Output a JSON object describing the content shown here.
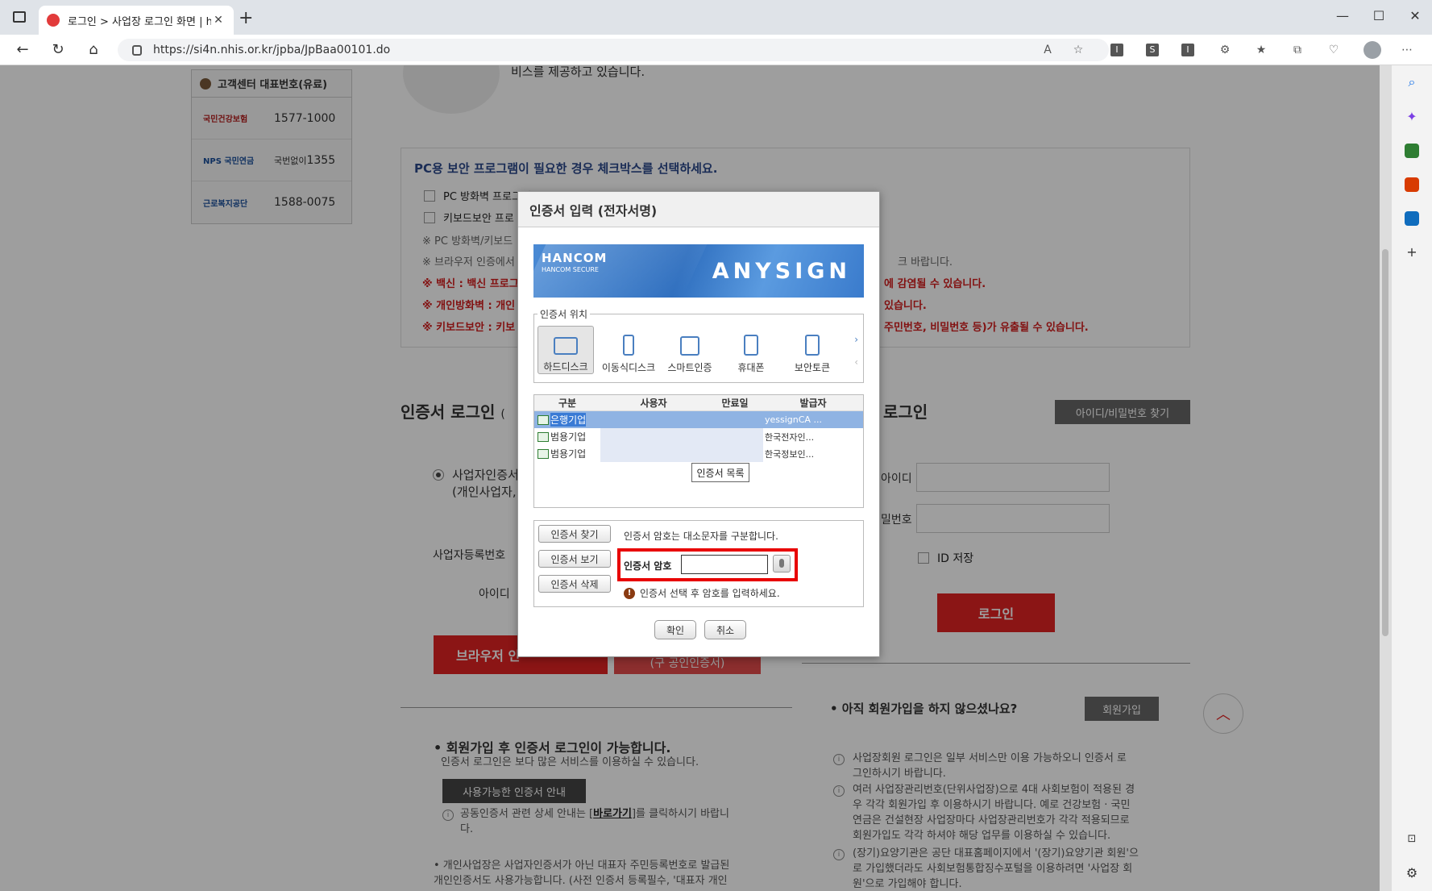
{
  "browser": {
    "tab_title": "로그인 > 사업장 로그인 화면 | h",
    "url": "https://si4n.nhis.or.kr/jpba/JpBaa00101.do"
  },
  "page": {
    "top_text": "비스를 제공하고 있습니다.",
    "customer_center": {
      "title": "고객센터 대표번호(유료)",
      "rows": [
        {
          "org": "국민건강보험",
          "num": "1577-1000"
        },
        {
          "org": "NPS 국민연금",
          "prefix": "국번없이",
          "num": "1355"
        },
        {
          "org": "근로복지공단",
          "num": "1588-0075"
        }
      ]
    },
    "security": {
      "title": "PC용 보안 프로그램이 필요한 경우 체크박스를 선택하세요.",
      "checkbox1": "PC 방화벽 프로그램 선택 설치",
      "checkbox2": "키보드보안 프로",
      "note1": "※ PC 방화벽/키보드",
      "note2": "※ 브라우저 인증에서",
      "note2_tail": "크 바랍니다.",
      "red1": "※ 백신 : 백신 프로그",
      "red1_tail": "에 감염될 수 있습니다.",
      "red2": "※ 개인방화벽 : 개인",
      "red2_tail": "있습니다.",
      "red3": "※ 키보드보안 : 키보",
      "red3_tail": "주민번호, 비밀번호 등)가 유출될 수 있습니다."
    },
    "cert_login": {
      "title": "인증서 로그인",
      "title_suffix": "(",
      "radio_label": "사업자인증서",
      "radio_sub": "(개인사업자,",
      "bizno_label": "사업자등록번호",
      "id_label": "아이디",
      "browser_btn": "브라우저 인",
      "browser_btn2": "(구 공인인증서)"
    },
    "id_login": {
      "title": "로그인",
      "find_btn": "아이디/비밀번호 찾기",
      "id_label": "아이디",
      "pw_label": "밀번호",
      "id_save": "ID 저장",
      "login_btn": "로그인"
    },
    "info": {
      "left_title": "• 회원가입 후 인증서 로그인이 가능합니다.",
      "left_sub": "인증서 로그인은 보다 많은 서비스를 이용하실 수 있습니다.",
      "avail_btn": "사용가능한 인증서 안내",
      "left_note_a": "공동인증서 관련 상세 안내는 [",
      "left_note_link": "바로가기",
      "left_note_b": "]를 클릭하시기 바랍니",
      "left_note_c": "다.",
      "left_bottom1": "• 개인사업장은 사업자인증서가 아닌 대표자 주민등록번호로 발급된",
      "left_bottom2": "개인인증서도 사용가능합니다. (사전 인증서 등록필수, '대표자 개인",
      "not_member": "• 아직 회원가입을 하지 않으셨나요?",
      "join_btn": "회원가입",
      "r1a": "사업장회원 로그인은 일부 서비스만 이용 가능하오니 인증서 로",
      "r1b": "그인하시기 바랍니다.",
      "r2a": "여러 사업장관리번호(단위사업장)으로 4대 사회보험이 적용된 경",
      "r2b": "우 각각 회원가입 후 이용하시기 바랍니다. 예로 건강보험 · 국민",
      "r2c": "연금은 건설현장 사업장마다 사업장관리번호가 각각 적용되므로",
      "r2d": "회원가입도 각각 하셔야 해당 업무를 이용하실 수 있습니다.",
      "r3a": "(장기)요양기관은 공단 대표홈페이지에서 '(장기)요양기관 회원'으",
      "r3b": "로 가입했더라도 사회보험통합징수포털을 이용하려면 '사업장 회",
      "r3c": "원'으로 가입해야 합니다."
    }
  },
  "dialog": {
    "title": "인증서 입력 (전자서명)",
    "banner": {
      "brand": "HANCOM",
      "sub": "HANCOM SECURE",
      "product": "ANYSIGN"
    },
    "location_legend": "인증서 위치",
    "locations": [
      "하드디스크",
      "이동식디스크",
      "스마트인증",
      "휴대폰",
      "보안토큰"
    ],
    "columns": [
      "구분",
      "사용자",
      "만료일",
      "발급자"
    ],
    "rows": [
      {
        "type": "은행기업",
        "user": "",
        "expiry": "",
        "issuer": "yessignCA ..."
      },
      {
        "type": "범용기업",
        "user": "",
        "expiry": "",
        "issuer": "한국전자인..."
      },
      {
        "type": "범용기업",
        "user": "",
        "expiry": "",
        "issuer": "한국정보인..."
      }
    ],
    "list_btn": "인증서 목록",
    "find_btn": "인증서 찾기",
    "view_btn": "인증서 보기",
    "delete_btn": "인증서 삭제",
    "case_note": "인증서 암호는 대소문자를 구분합니다.",
    "pw_label": "인증서 암호",
    "pw_value": "",
    "warning": "인증서 선택 후 암호를 입력하세요.",
    "ok": "확인",
    "cancel": "취소"
  },
  "colors": {
    "accent_red": "#e02222",
    "highlight": "#e80000",
    "banner_blue": "#2f6fbf"
  }
}
